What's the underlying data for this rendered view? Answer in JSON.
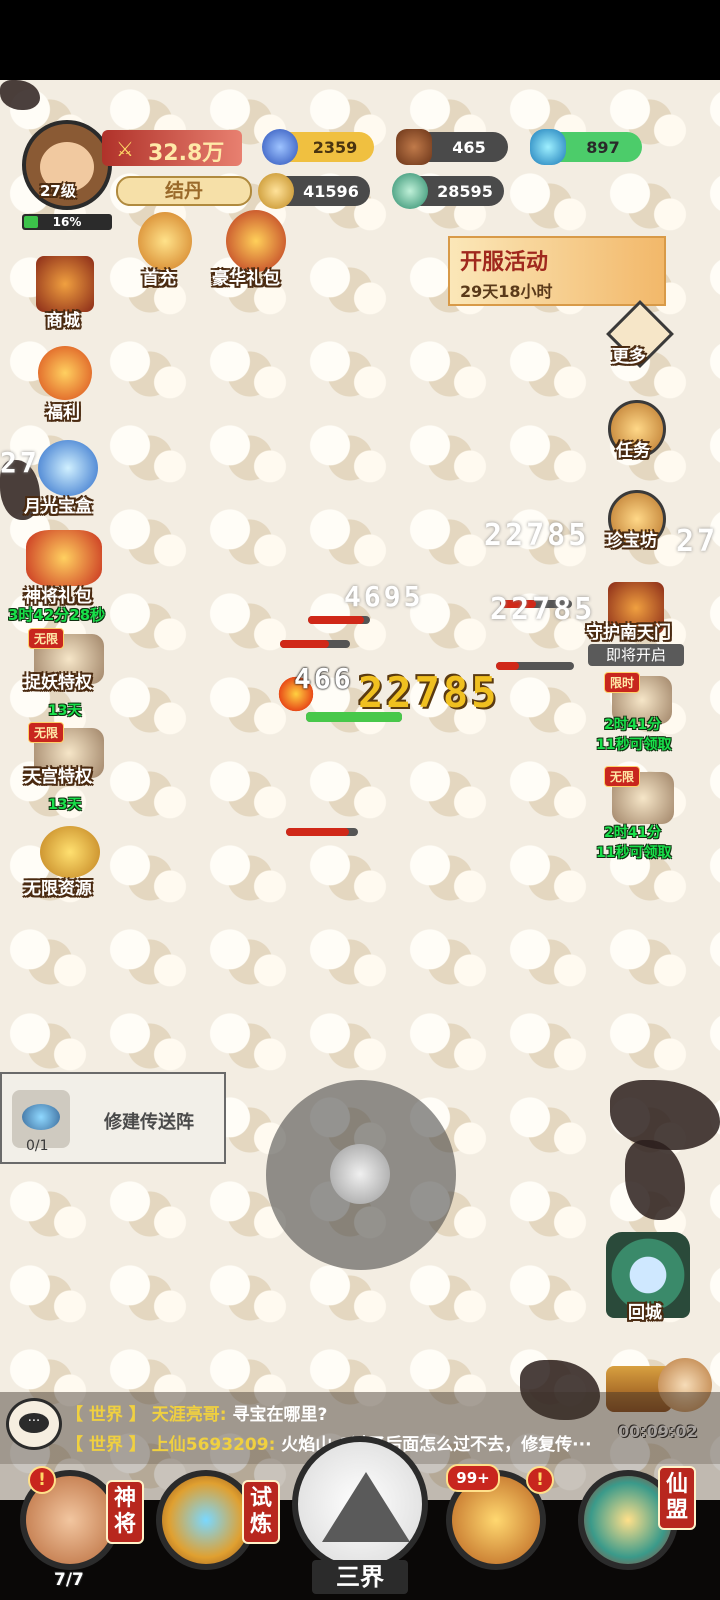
{
  "player": {
    "level": "27级",
    "exp_percent": "16%",
    "exp_fraction": 0.16,
    "rank": "结丹",
    "power": "32.8万"
  },
  "resources": {
    "orb": "2359",
    "wood": "465",
    "gem": "897",
    "coin": "41596",
    "jade": "28595"
  },
  "left_menu": {
    "first_charge": "首充",
    "luxury_pack": "豪华礼包",
    "shop": "商城",
    "welfare": "福利",
    "moonlight_box": "月光宝盒",
    "general_pack": "神将礼包",
    "general_pack_timer": "3时42分28秒",
    "demon_card": "捉妖特权",
    "demon_card_tag": "无限",
    "demon_card_days": "13天",
    "palace_card": "天宫特权",
    "palace_card_tag": "无限",
    "palace_card_days": "13天",
    "unlimited_res": "无限资源"
  },
  "event_banner": {
    "title": "开服活动",
    "countdown": "29天18小时"
  },
  "right_menu": {
    "more": "更多",
    "tasks": "任务",
    "treasure": "珍宝坊",
    "south_gate": "守护南天门",
    "south_gate_status": "即将开启",
    "limited_tag": "限时",
    "limited_timer_a": "2时41分",
    "limited_timer_b": "11秒可领取",
    "unlimited_tag": "无限",
    "unlimited_timer_a": "2时41分",
    "unlimited_timer_b": "11秒可领取",
    "return_city": "回城",
    "idle_timer": "00:09:02"
  },
  "damage_numbers": {
    "big": "22785",
    "right_1": "22785",
    "right_2": "22785",
    "mid": "4695",
    "hit": "466",
    "edge_right": "27",
    "edge_left": "27"
  },
  "quest": {
    "title": "修建传送阵",
    "progress": "0/1"
  },
  "chat": {
    "lines": [
      {
        "channel": "【 世界 】",
        "user": "天涯亮哥:",
        "message": "寻宝在哪里?"
      },
      {
        "channel": "【 世界 】",
        "user": "上仙5693209:",
        "message": "火焰山-3过了后面怎么过不去，修复传···"
      }
    ]
  },
  "bottom_nav": {
    "generals": "神将",
    "generals_count": "7/7",
    "trial": "试炼",
    "three_realms": "三界",
    "treasure_count": "99+",
    "alliance": "仙盟",
    "alert_mark": "!"
  },
  "colors": {
    "accent_red": "#b8271e",
    "gold": "#f0c040",
    "text_green": "#18e04a"
  }
}
